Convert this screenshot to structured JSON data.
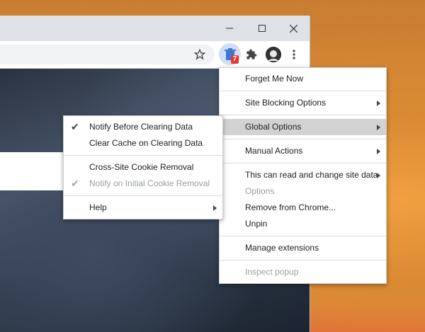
{
  "window": {
    "minimize_label": "—",
    "maximize_label": "☐",
    "close_label": "✕"
  },
  "toolbar": {
    "extension_badge": "7"
  },
  "ext_menu": {
    "items": [
      {
        "label": "Forget Me Now",
        "submenu": false,
        "disabled": false
      },
      {
        "label": "Site Blocking Options",
        "submenu": true,
        "disabled": false
      },
      {
        "label": "Global Options",
        "submenu": true,
        "disabled": false,
        "highlighted": true
      },
      {
        "label": "Manual Actions",
        "submenu": true,
        "disabled": false
      },
      {
        "label": "This can read and change site data",
        "submenu": true,
        "disabled": false
      },
      {
        "label": "Options",
        "submenu": false,
        "disabled": true
      },
      {
        "label": "Remove from Chrome...",
        "submenu": false,
        "disabled": false
      },
      {
        "label": "Unpin",
        "submenu": false,
        "disabled": false
      },
      {
        "label": "Manage extensions",
        "submenu": false,
        "disabled": false
      },
      {
        "label": "Inspect popup",
        "submenu": false,
        "disabled": true
      }
    ]
  },
  "global_submenu": {
    "items": [
      {
        "label": "Notify Before Clearing Data",
        "checked": true,
        "disabled": false
      },
      {
        "label": "Clear Cache on Clearing Data",
        "checked": false,
        "disabled": false
      },
      {
        "label": "Cross-Site Cookie Removal",
        "checked": false,
        "disabled": false
      },
      {
        "label": "Notify on Initial Cookie Removal",
        "checked": true,
        "disabled": true
      },
      {
        "label": "Help",
        "checked": false,
        "disabled": false,
        "submenu": true
      }
    ]
  },
  "colors": {
    "badge": "#e53935",
    "highlight": "#d2d2d2",
    "disabled_text": "#9aa0a6"
  }
}
